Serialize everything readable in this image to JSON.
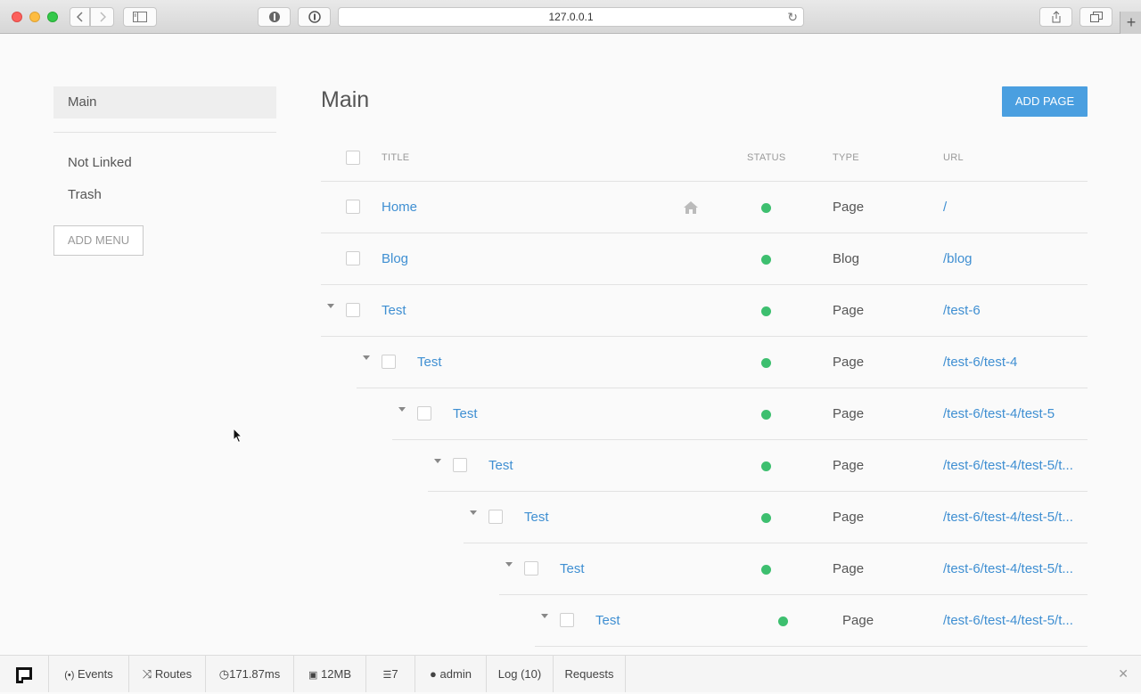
{
  "browser": {
    "url": "127.0.0.1"
  },
  "sidebar": {
    "active": "Main",
    "items": [
      "Not Linked",
      "Trash"
    ],
    "add_menu": "ADD MENU"
  },
  "main": {
    "title": "Main",
    "add_page": "ADD PAGE",
    "columns": {
      "title": "TITLE",
      "status": "STATUS",
      "type": "TYPE",
      "url": "URL"
    },
    "rows": [
      {
        "title": "Home",
        "type": "Page",
        "url": "/",
        "status": "published",
        "home": true,
        "expanded": false
      },
      {
        "title": "Blog",
        "type": "Blog",
        "url": "/blog",
        "status": "published",
        "expanded": false
      },
      {
        "title": "Test",
        "type": "Page",
        "url": "/test-6",
        "status": "published",
        "expanded": true
      },
      {
        "title": "Test",
        "type": "Page",
        "url": "/test-6/test-4",
        "status": "published",
        "expanded": true
      },
      {
        "title": "Test",
        "type": "Page",
        "url": "/test-6/test-4/test-5",
        "status": "published",
        "expanded": true
      },
      {
        "title": "Test",
        "type": "Page",
        "url": "/test-6/test-4/test-5/t...",
        "status": "published",
        "expanded": true
      },
      {
        "title": "Test",
        "type": "Page",
        "url": "/test-6/test-4/test-5/t...",
        "status": "published",
        "expanded": true
      },
      {
        "title": "Test",
        "type": "Page",
        "url": "/test-6/test-4/test-5/t...",
        "status": "published",
        "expanded": true
      },
      {
        "title": "Test",
        "type": "Page",
        "url": "/test-6/test-4/test-5/t...",
        "status": "published",
        "expanded": true
      }
    ],
    "status_color": "#3dbf6f",
    "link_color": "#3f8fd2",
    "accent_color": "#4a9fe0"
  },
  "debugbar": {
    "events": "Events",
    "routes": "Routes",
    "time": "171.87ms",
    "memory": "12MB",
    "queries": "7",
    "user": "admin",
    "log": "Log (10)",
    "requests": "Requests"
  }
}
